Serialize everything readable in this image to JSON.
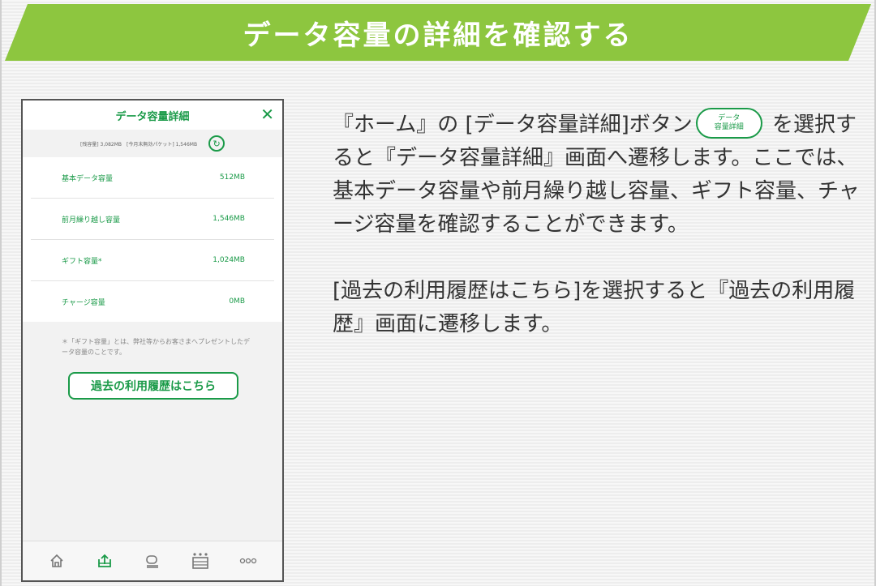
{
  "banner": {
    "title": "データ容量の詳細を確認する"
  },
  "phone": {
    "title": "データ容量詳細",
    "close_icon": "close-icon",
    "info_text": "[残容量] 3,082MB　[今月末無効パケット] 1,546MB",
    "refresh_icon": "refresh-icon",
    "rows": [
      {
        "label": "基本データ容量",
        "value": "512MB"
      },
      {
        "label": "前月繰り越し容量",
        "value": "1,546MB"
      },
      {
        "label": "ギフト容量*",
        "value": "1,024MB"
      },
      {
        "label": "チャージ容量",
        "value": "0MB"
      }
    ],
    "note": "＊「ギフト容量」とは、弊社等からお客さまへプレゼントしたデータ容量のことです。",
    "history_button": "過去の利用履歴はこちら",
    "nav_icons": [
      "home-icon",
      "data-usage-icon",
      "plan-icon",
      "shop-icon",
      "more-icon"
    ],
    "accent_color": "#1a9a48"
  },
  "description": {
    "p1_before": "『ホーム』の [データ容量詳細]ボタン",
    "inline_button_line1": "データ",
    "inline_button_line2": "容量詳細",
    "p1_after": " を選択すると『データ容量詳細』画面へ遷移します。ここでは、基本データ容量や前月繰り越し容量、ギフト容量、チャージ容量を確認することができます。",
    "p2": "[過去の利用履歴はこちら]を選択すると『過去の利用履歴』画面に遷移します。"
  },
  "colors": {
    "banner": "#8dc63f"
  }
}
